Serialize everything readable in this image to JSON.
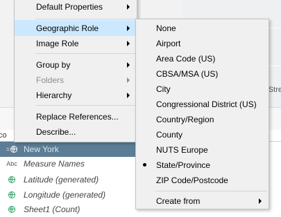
{
  "menu": {
    "items": [
      {
        "label": "Default Properties",
        "submenu": true
      },
      {
        "label": "Geographic Role",
        "submenu": true,
        "highlighted": true
      },
      {
        "label": "Image Role",
        "submenu": true
      },
      {
        "label": "Group by",
        "submenu": true
      },
      {
        "label": "Folders",
        "submenu": true,
        "disabled": true
      },
      {
        "label": "Hierarchy",
        "submenu": true
      },
      {
        "label": "Replace References..."
      },
      {
        "label": "Describe..."
      }
    ]
  },
  "submenu": {
    "items": [
      {
        "label": "None"
      },
      {
        "label": "Airport"
      },
      {
        "label": "Area Code (US)"
      },
      {
        "label": "CBSA/MSA (US)"
      },
      {
        "label": "City"
      },
      {
        "label": "Congressional District (US)"
      },
      {
        "label": "Country/Region"
      },
      {
        "label": "County"
      },
      {
        "label": "NUTS Europe"
      },
      {
        "label": "State/Province",
        "checked": true
      },
      {
        "label": "ZIP Code/Postcode"
      },
      {
        "label": "Create from",
        "submenu": true
      }
    ]
  },
  "data_pane": {
    "fields": [
      {
        "label": "New York",
        "icon": "globe-icon",
        "selected": true
      },
      {
        "label": "Measure Names",
        "icon": "Abc"
      },
      {
        "label": "Latitude (generated)",
        "icon": "globe-icon"
      },
      {
        "label": "Longitude (generated)",
        "icon": "globe-icon"
      },
      {
        "label": "Sheet1 (Count)",
        "icon": "globe-icon"
      }
    ]
  },
  "background": {
    "map_label_partial": "Stre",
    "pane_label_partial": "co"
  },
  "colors": {
    "highlight": "#cce8ff",
    "selected_row": "#5b7d95",
    "geo_icon": "#2e9e63"
  }
}
